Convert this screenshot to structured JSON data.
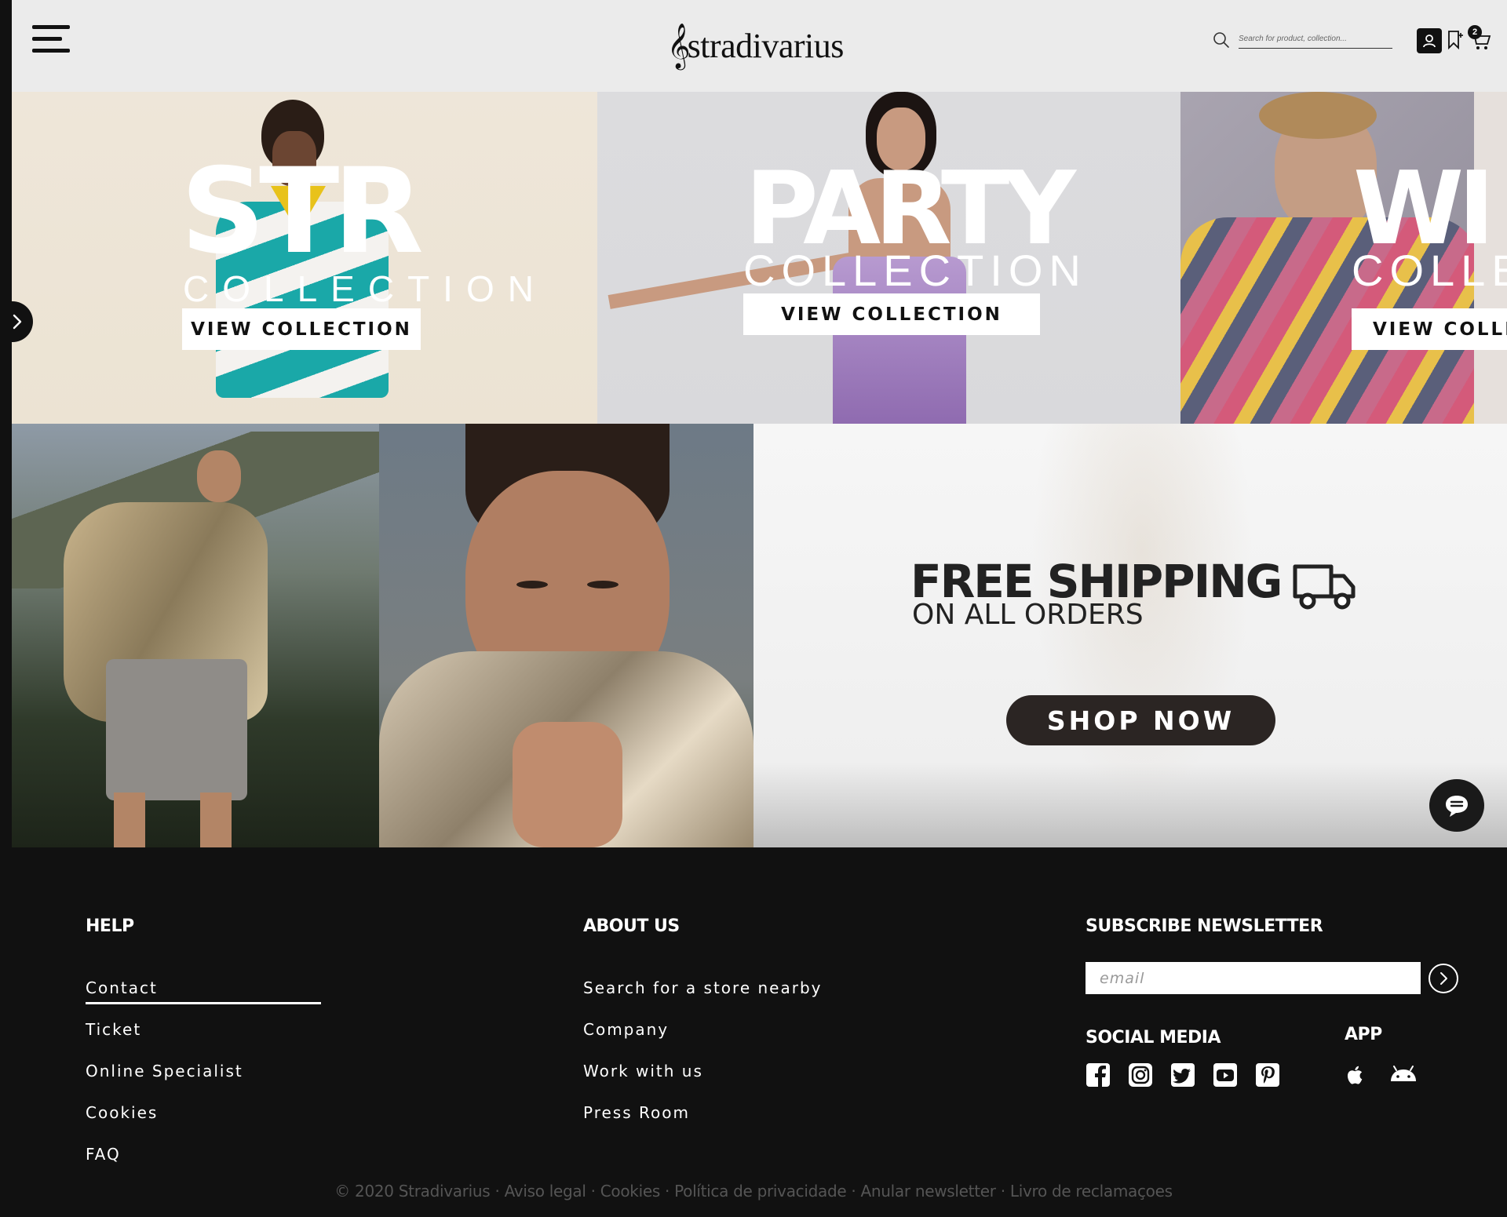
{
  "header": {
    "logo_text": "stradivarius",
    "search_placeholder": "Search for product, collection...",
    "cart_count": "2"
  },
  "banners": [
    {
      "big_word": "STR",
      "collection_word": "COLLECTION",
      "button_label": "VIEW COLLECTION"
    },
    {
      "big_word": "PARTY",
      "collection_word": "COLLECTION",
      "button_label": "VIEW COLLECTION"
    },
    {
      "big_word": "WI",
      "collection_word": "COLLE",
      "button_label": "VIEW COLLE"
    }
  ],
  "promo": {
    "title": "FREE SHIPPING",
    "subtitle": "ON ALL ORDERS",
    "button_label": "SHOP NOW"
  },
  "footer": {
    "help": {
      "heading": "HELP",
      "links": [
        "Contact",
        "Ticket",
        "Online Specialist",
        "Cookies",
        "FAQ"
      ]
    },
    "about": {
      "heading": "ABOUT US",
      "links": [
        "Search for a store nearby",
        "Company",
        "Work with us",
        "Press Room"
      ]
    },
    "newsletter": {
      "heading": "SUBSCRIBE NEWSLETTER",
      "email_placeholder": "email"
    },
    "social": {
      "heading": "SOCIAL MEDIA",
      "icons": [
        "facebook-icon",
        "instagram-icon",
        "twitter-icon",
        "youtube-icon",
        "pinterest-icon"
      ]
    },
    "app": {
      "heading": "APP",
      "icons": [
        "apple-icon",
        "android-icon"
      ]
    },
    "copyright": "© 2020 Stradivarius · Aviso legal · Cookies · Política de privacidade · Anular newsletter · Livro de reclamaçoes"
  },
  "colors": {
    "footer_bg": "#111111",
    "header_bg": "#ebebeb",
    "shop_button": "#2b2523"
  }
}
